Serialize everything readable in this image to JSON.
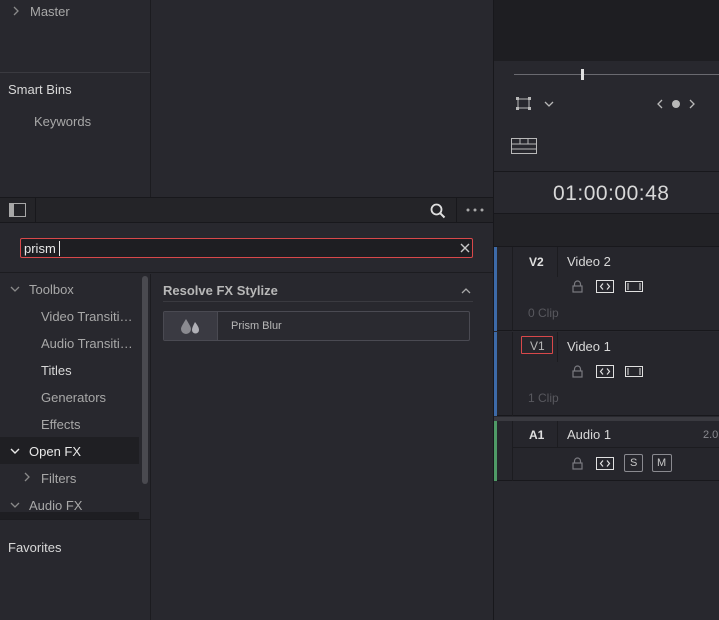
{
  "media_pool": {
    "master_label": "Master",
    "smart_bins_label": "Smart Bins",
    "keywords_label": "Keywords"
  },
  "effects_library": {
    "search_value": "prism",
    "tree": {
      "toolbox": "Toolbox",
      "video_transitions": "Video Transiti…",
      "audio_transitions": "Audio Transiti…",
      "titles": "Titles",
      "generators": "Generators",
      "effects": "Effects",
      "open_fx": "Open FX",
      "filters": "Filters",
      "audio_fx": "Audio FX"
    },
    "favorites_label": "Favorites",
    "results": {
      "group_title": "Resolve FX Stylize",
      "item_label": "Prism Blur"
    }
  },
  "viewer": {
    "timecode": "01:00:00:48"
  },
  "timeline": {
    "tracks": [
      {
        "id": "V2",
        "name": "Video 2",
        "clips": "0 Clip",
        "color": "#3d6aa8"
      },
      {
        "id": "V1",
        "name": "Video 1",
        "clips": "1 Clip",
        "color": "#3d6aa8"
      },
      {
        "id": "A1",
        "name": "Audio 1",
        "channels": "2.0",
        "solo": "S",
        "mute": "M",
        "color": "#4f9a66"
      }
    ]
  },
  "colors": {
    "accent_red": "#d8484a",
    "panel_bg": "#28282e",
    "track_header_bg": "#26262c"
  }
}
